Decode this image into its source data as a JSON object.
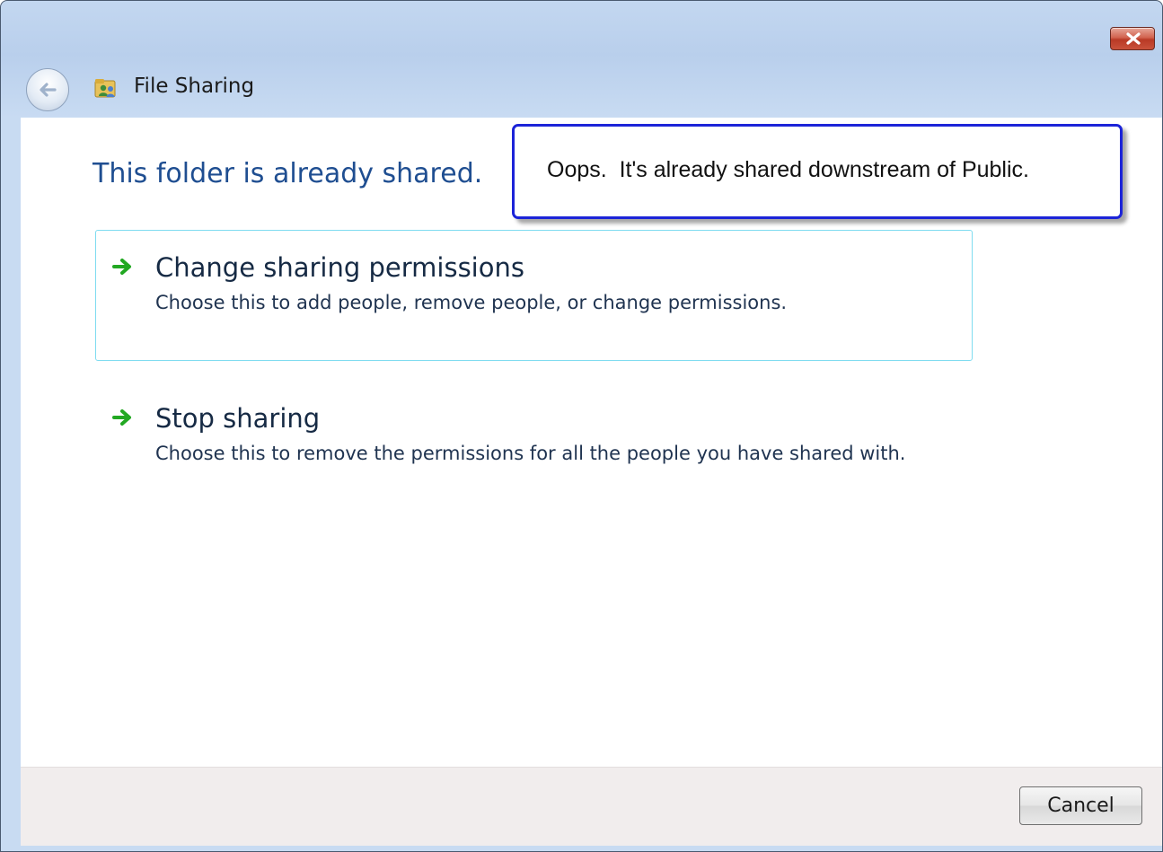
{
  "window": {
    "title": "File Sharing",
    "icons": {
      "back": "back-arrow-icon",
      "app": "file-sharing-icon",
      "close": "close-icon"
    }
  },
  "main": {
    "heading": "This folder is already shared.",
    "options": [
      {
        "title": "Change sharing permissions",
        "description": "Choose this to add people, remove people, or change permissions.",
        "icon": "green-arrow-icon"
      },
      {
        "title": "Stop sharing",
        "description": "Choose this to remove the permissions for all the people you have shared with.",
        "icon": "green-arrow-icon"
      }
    ]
  },
  "footer": {
    "cancel_label": "Cancel"
  },
  "annotation": {
    "text": "Oops.  It's already shared downstream of Public."
  },
  "colors": {
    "heading": "#1f4e91",
    "hover_border": "#7fdcf0",
    "callout_border": "#1c24d8",
    "arrow": "#22a822"
  }
}
